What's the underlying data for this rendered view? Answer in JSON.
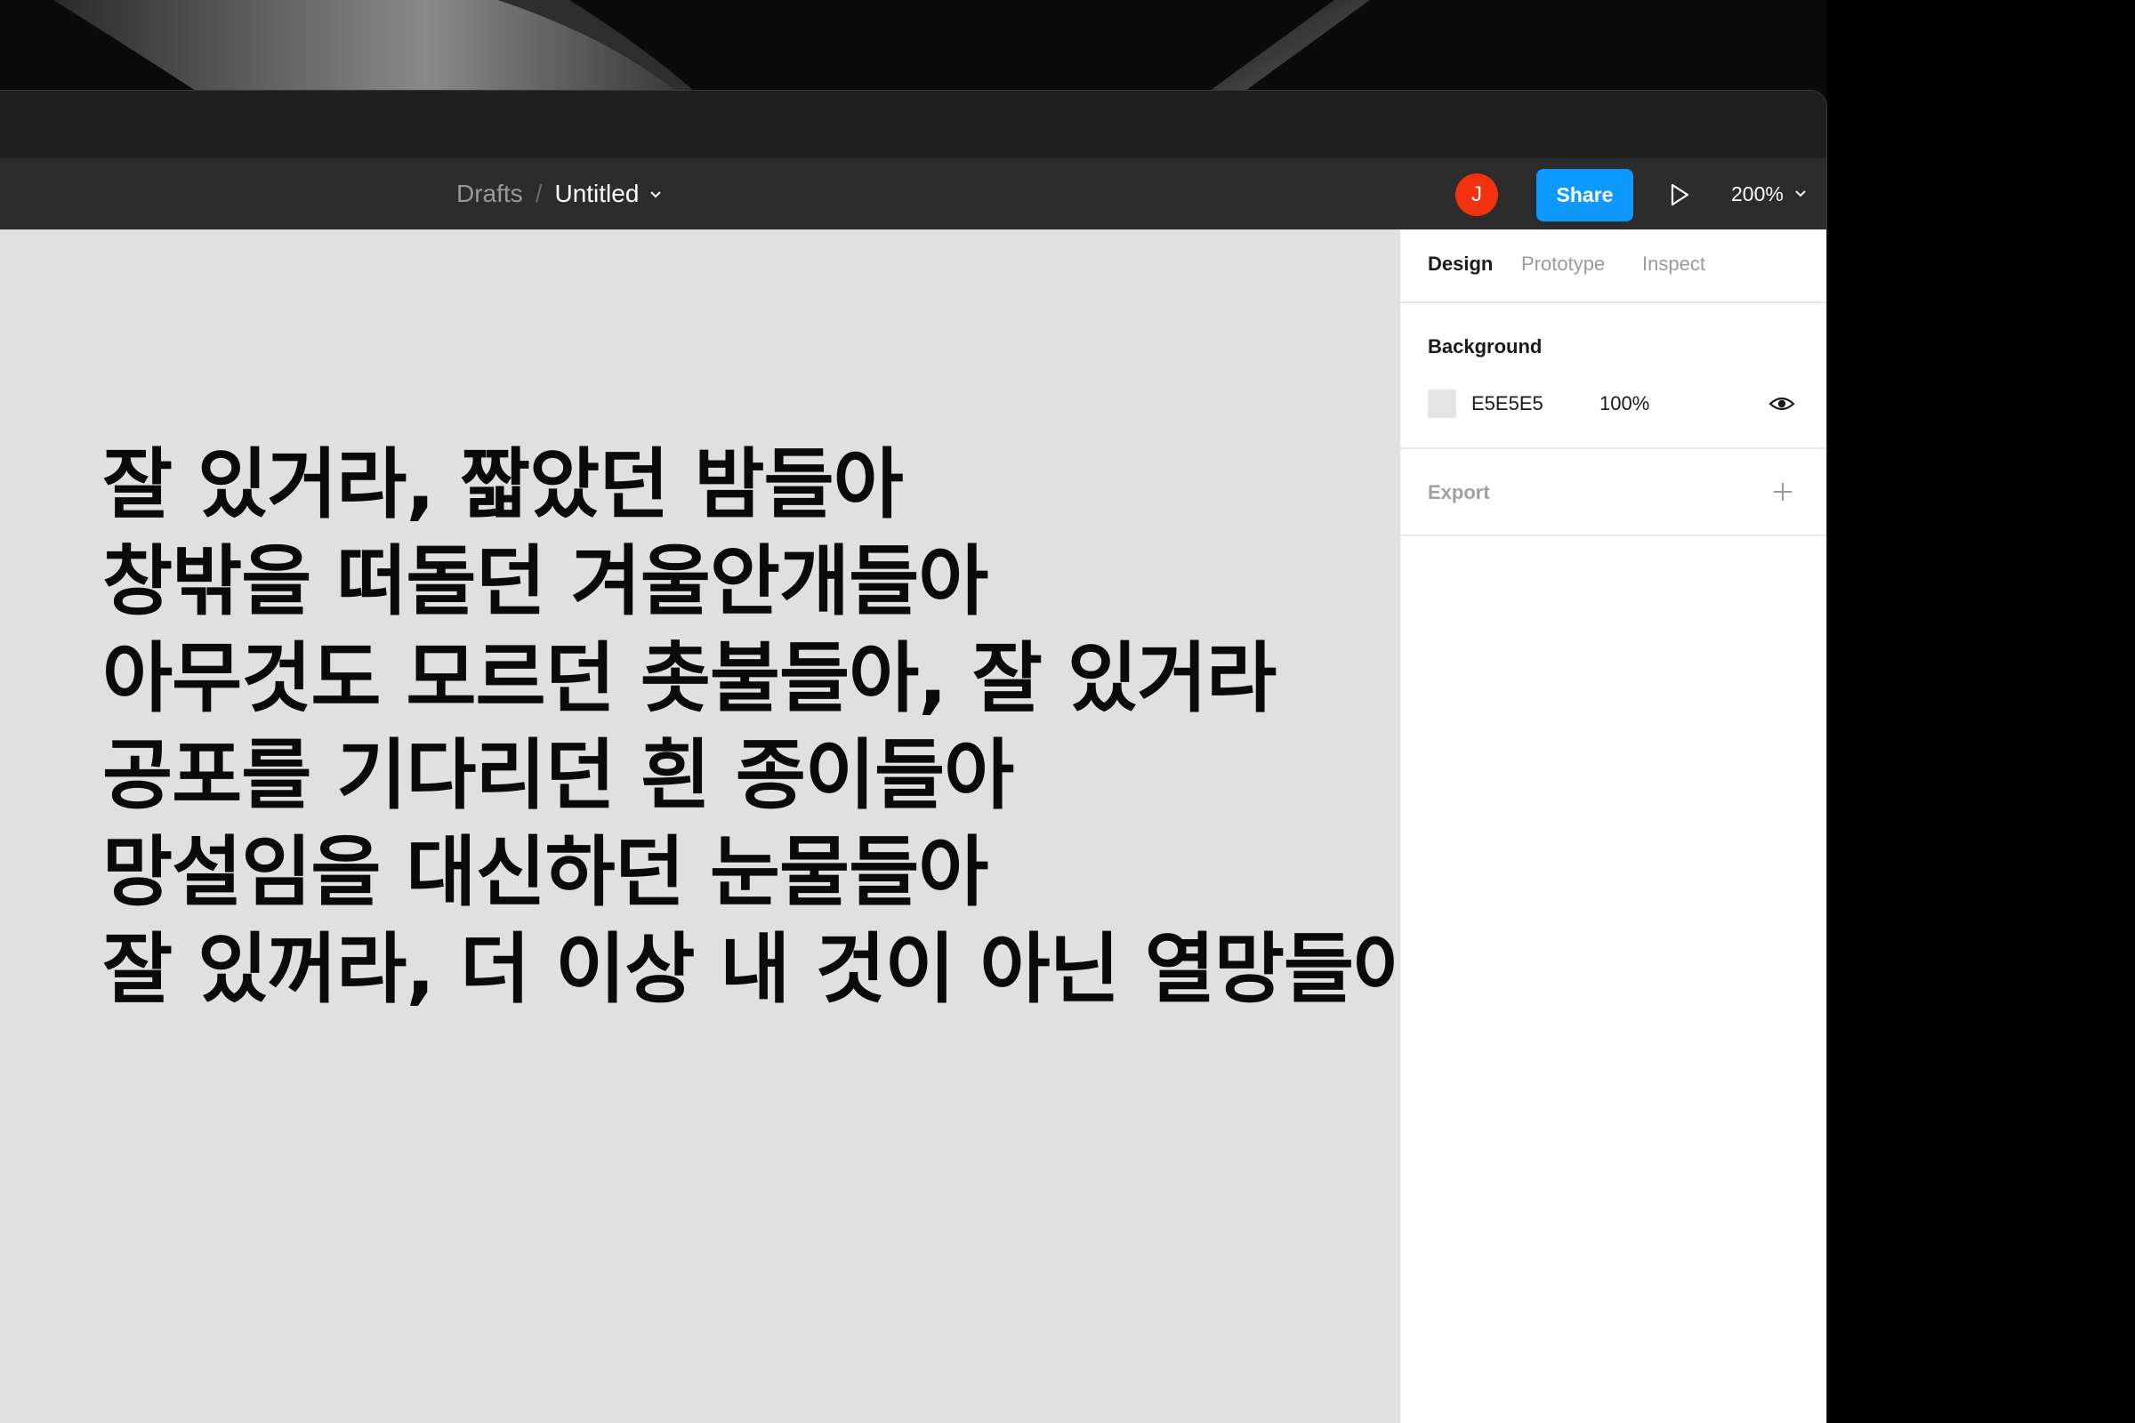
{
  "breadcrumb": {
    "folder": "Drafts",
    "separator": "/",
    "file_name": "Untitled"
  },
  "toolbar": {
    "avatar_initial": "J",
    "share_label": "Share",
    "zoom_level": "200%"
  },
  "canvas": {
    "background_color": "#e0e0e0",
    "poem_lines": [
      "잘 있거라, 짧았던 밤들아",
      "창밖을 떠돌던 겨울안개들아",
      "아무것도 모르던 촛불들아, 잘 있거라",
      "공포를 기다리던 흰 종이들아",
      "망설임을 대신하던 눈물들아",
      "잘 있꺼라, 더 이상 내 것이 아닌 열망들아"
    ]
  },
  "panel": {
    "tabs": [
      {
        "label": "Design",
        "active": true
      },
      {
        "label": "Prototype",
        "active": false
      },
      {
        "label": "Inspect",
        "active": false
      }
    ],
    "background": {
      "title": "Background",
      "hex": "E5E5E5",
      "opacity": "100%",
      "swatch_color": "#e5e5e5"
    },
    "export": {
      "title": "Export"
    }
  },
  "colors": {
    "accent": "#0d99ff",
    "avatar": "#f2320f",
    "toolbar": "#2c2c2c"
  }
}
